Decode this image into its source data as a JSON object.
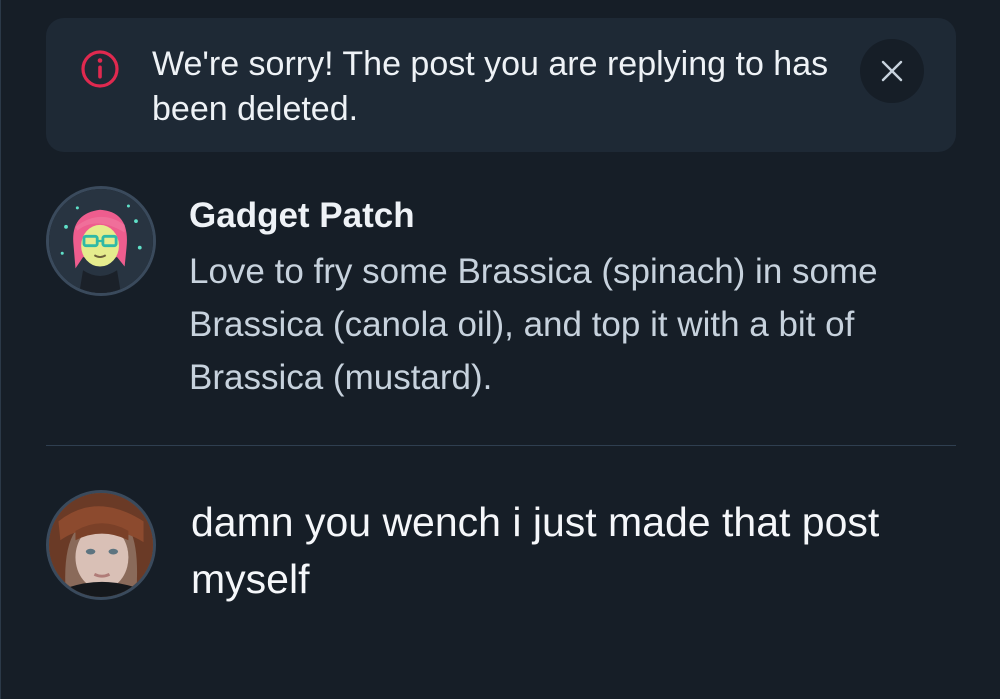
{
  "notice": {
    "message": "We're sorry! The post you are replying to has been deleted.",
    "icon": "info-circle-icon",
    "icon_color": "#e0294f",
    "close_icon": "close-icon"
  },
  "quoted_post": {
    "author": "Gadget Patch",
    "text": "Love to fry some Brassica (spinach) in some Brassica (canola oil), and top it with a bit of Brassica (mustard)."
  },
  "reply_draft": {
    "text": "damn you wench i just made that post myself"
  },
  "colors": {
    "background": "#161e27",
    "banner": "#1e2935",
    "divider": "#2f3f50",
    "text_primary": "#eef2f6",
    "text_secondary": "#c7d2dd"
  }
}
